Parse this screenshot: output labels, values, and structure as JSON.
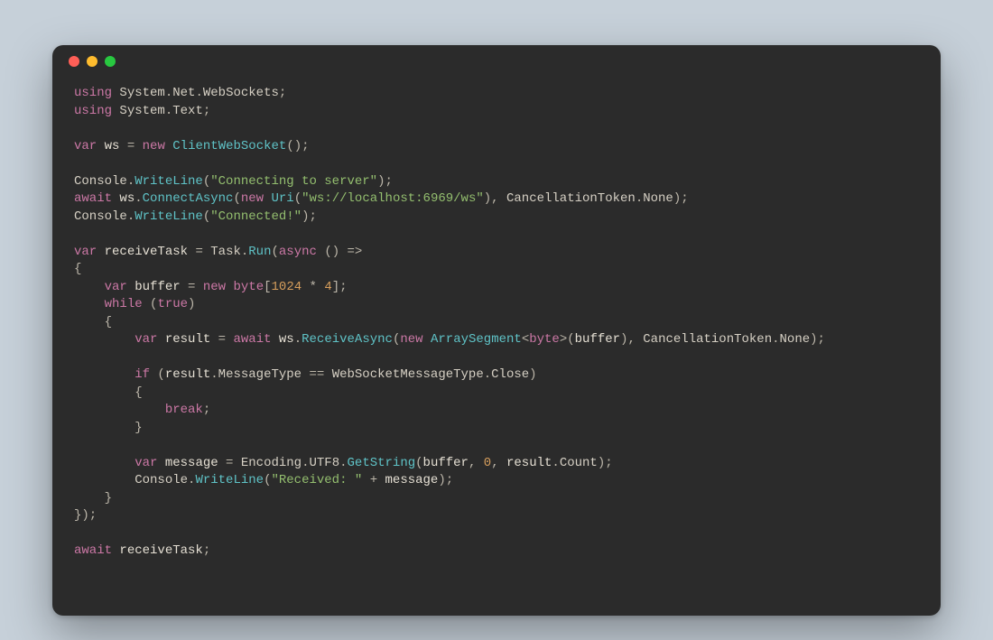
{
  "colors": {
    "background_page": "#c6d0d9",
    "window_bg": "#2b2b2b",
    "dot_red": "#ff5f57",
    "dot_yellow": "#febc2e",
    "dot_green": "#28c840",
    "text_default": "#d6d0c4",
    "keyword": "#cc78a6",
    "type": "#5fc3c7",
    "string": "#94bf6f",
    "number": "#d69e5c"
  },
  "code": {
    "tokens": [
      [
        [
          "kw",
          "using"
        ],
        [
          "punct",
          " "
        ],
        [
          "prop",
          "System"
        ],
        [
          "punct",
          "."
        ],
        [
          "prop",
          "Net"
        ],
        [
          "punct",
          "."
        ],
        [
          "prop",
          "WebSockets"
        ],
        [
          "punct",
          ";"
        ]
      ],
      [
        [
          "kw",
          "using"
        ],
        [
          "punct",
          " "
        ],
        [
          "prop",
          "System"
        ],
        [
          "punct",
          "."
        ],
        [
          "prop",
          "Text"
        ],
        [
          "punct",
          ";"
        ]
      ],
      [],
      [
        [
          "kw",
          "var"
        ],
        [
          "punct",
          " "
        ],
        [
          "ident",
          "ws"
        ],
        [
          "punct",
          " = "
        ],
        [
          "kw",
          "new"
        ],
        [
          "punct",
          " "
        ],
        [
          "type",
          "ClientWebSocket"
        ],
        [
          "punct",
          "();"
        ]
      ],
      [],
      [
        [
          "prop",
          "Console"
        ],
        [
          "punct",
          "."
        ],
        [
          "method",
          "WriteLine"
        ],
        [
          "punct",
          "("
        ],
        [
          "string",
          "\"Connecting to server\""
        ],
        [
          "punct",
          ");"
        ]
      ],
      [
        [
          "kw",
          "await"
        ],
        [
          "punct",
          " "
        ],
        [
          "ident",
          "ws"
        ],
        [
          "punct",
          "."
        ],
        [
          "method",
          "ConnectAsync"
        ],
        [
          "punct",
          "("
        ],
        [
          "kw",
          "new"
        ],
        [
          "punct",
          " "
        ],
        [
          "type",
          "Uri"
        ],
        [
          "punct",
          "("
        ],
        [
          "string",
          "\"ws://localhost:6969/ws\""
        ],
        [
          "punct",
          "), "
        ],
        [
          "prop",
          "CancellationToken"
        ],
        [
          "punct",
          "."
        ],
        [
          "prop",
          "None"
        ],
        [
          "punct",
          ");"
        ]
      ],
      [
        [
          "prop",
          "Console"
        ],
        [
          "punct",
          "."
        ],
        [
          "method",
          "WriteLine"
        ],
        [
          "punct",
          "("
        ],
        [
          "string",
          "\"Connected!\""
        ],
        [
          "punct",
          ");"
        ]
      ],
      [],
      [
        [
          "kw",
          "var"
        ],
        [
          "punct",
          " "
        ],
        [
          "ident",
          "receiveTask"
        ],
        [
          "punct",
          " = "
        ],
        [
          "prop",
          "Task"
        ],
        [
          "punct",
          "."
        ],
        [
          "method",
          "Run"
        ],
        [
          "punct",
          "("
        ],
        [
          "kw",
          "async"
        ],
        [
          "punct",
          " () =>"
        ]
      ],
      [
        [
          "punct",
          "{"
        ]
      ],
      [
        [
          "punct",
          "    "
        ],
        [
          "kw",
          "var"
        ],
        [
          "punct",
          " "
        ],
        [
          "ident",
          "buffer"
        ],
        [
          "punct",
          " = "
        ],
        [
          "kw",
          "new"
        ],
        [
          "punct",
          " "
        ],
        [
          "kw",
          "byte"
        ],
        [
          "punct",
          "["
        ],
        [
          "num",
          "1024"
        ],
        [
          "punct",
          " * "
        ],
        [
          "num",
          "4"
        ],
        [
          "punct",
          "];"
        ]
      ],
      [
        [
          "punct",
          "    "
        ],
        [
          "kw",
          "while"
        ],
        [
          "punct",
          " ("
        ],
        [
          "kw",
          "true"
        ],
        [
          "punct",
          ")"
        ]
      ],
      [
        [
          "punct",
          "    {"
        ]
      ],
      [
        [
          "punct",
          "        "
        ],
        [
          "kw",
          "var"
        ],
        [
          "punct",
          " "
        ],
        [
          "ident",
          "result"
        ],
        [
          "punct",
          " = "
        ],
        [
          "kw",
          "await"
        ],
        [
          "punct",
          " "
        ],
        [
          "ident",
          "ws"
        ],
        [
          "punct",
          "."
        ],
        [
          "method",
          "ReceiveAsync"
        ],
        [
          "punct",
          "("
        ],
        [
          "kw",
          "new"
        ],
        [
          "punct",
          " "
        ],
        [
          "type",
          "ArraySegment"
        ],
        [
          "punct",
          "<"
        ],
        [
          "kw",
          "byte"
        ],
        [
          "punct",
          ">("
        ],
        [
          "ident",
          "buffer"
        ],
        [
          "punct",
          "), "
        ],
        [
          "prop",
          "CancellationToken"
        ],
        [
          "punct",
          "."
        ],
        [
          "prop",
          "None"
        ],
        [
          "punct",
          ");"
        ]
      ],
      [],
      [
        [
          "punct",
          "        "
        ],
        [
          "kw",
          "if"
        ],
        [
          "punct",
          " ("
        ],
        [
          "ident",
          "result"
        ],
        [
          "punct",
          "."
        ],
        [
          "prop",
          "MessageType"
        ],
        [
          "punct",
          " == "
        ],
        [
          "prop",
          "WebSocketMessageType"
        ],
        [
          "punct",
          "."
        ],
        [
          "prop",
          "Close"
        ],
        [
          "punct",
          ")"
        ]
      ],
      [
        [
          "punct",
          "        {"
        ]
      ],
      [
        [
          "punct",
          "            "
        ],
        [
          "kw",
          "break"
        ],
        [
          "punct",
          ";"
        ]
      ],
      [
        [
          "punct",
          "        }"
        ]
      ],
      [],
      [
        [
          "punct",
          "        "
        ],
        [
          "kw",
          "var"
        ],
        [
          "punct",
          " "
        ],
        [
          "ident",
          "message"
        ],
        [
          "punct",
          " = "
        ],
        [
          "prop",
          "Encoding"
        ],
        [
          "punct",
          "."
        ],
        [
          "prop",
          "UTF8"
        ],
        [
          "punct",
          "."
        ],
        [
          "method",
          "GetString"
        ],
        [
          "punct",
          "("
        ],
        [
          "ident",
          "buffer"
        ],
        [
          "punct",
          ", "
        ],
        [
          "num",
          "0"
        ],
        [
          "punct",
          ", "
        ],
        [
          "ident",
          "result"
        ],
        [
          "punct",
          "."
        ],
        [
          "prop",
          "Count"
        ],
        [
          "punct",
          ");"
        ]
      ],
      [
        [
          "punct",
          "        "
        ],
        [
          "prop",
          "Console"
        ],
        [
          "punct",
          "."
        ],
        [
          "method",
          "WriteLine"
        ],
        [
          "punct",
          "("
        ],
        [
          "string",
          "\"Received: \""
        ],
        [
          "punct",
          " + "
        ],
        [
          "ident",
          "message"
        ],
        [
          "punct",
          ");"
        ]
      ],
      [
        [
          "punct",
          "    }"
        ]
      ],
      [
        [
          "punct",
          "});"
        ]
      ],
      [],
      [
        [
          "kw",
          "await"
        ],
        [
          "punct",
          " "
        ],
        [
          "ident",
          "receiveTask"
        ],
        [
          "punct",
          ";"
        ]
      ]
    ]
  }
}
